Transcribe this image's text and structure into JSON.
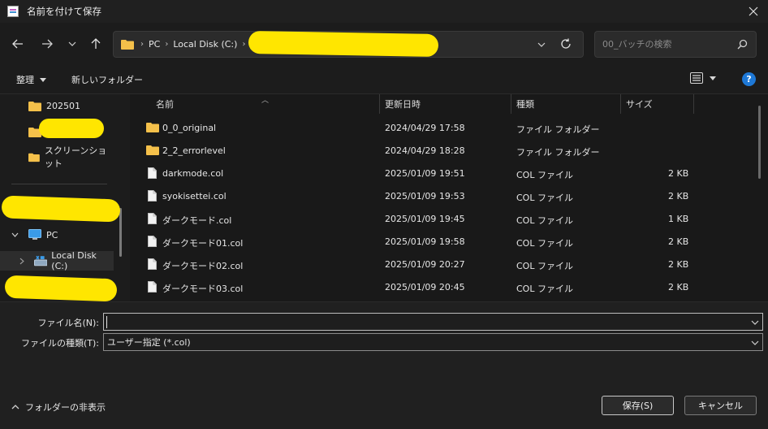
{
  "window": {
    "title": "名前を付けて保存"
  },
  "breadcrumbs": [
    "PC",
    "Local Disk (C:)"
  ],
  "search": {
    "placeholder": "00_バッチの検索"
  },
  "toolbar": {
    "organize": "整理",
    "new_folder": "新しいフォルダー"
  },
  "nav": {
    "items": [
      {
        "label": "202501",
        "icon": "folder-icon"
      },
      {
        "label": "",
        "icon": "folder-icon"
      },
      {
        "label": "スクリーンショット",
        "icon": "folder-icon"
      }
    ],
    "pc_label": "PC",
    "disk_label": "Local Disk (C:)"
  },
  "columns": {
    "name": "名前",
    "date": "更新日時",
    "type": "種類",
    "size": "サイズ"
  },
  "files": [
    {
      "name": "0_0_original",
      "date": "2024/04/29 17:58",
      "type": "ファイル フォルダー",
      "size": "",
      "icon": "folder-icon"
    },
    {
      "name": "2_2_errorlevel",
      "date": "2024/04/29 18:28",
      "type": "ファイル フォルダー",
      "size": "",
      "icon": "folder-icon"
    },
    {
      "name": "darkmode.col",
      "date": "2025/01/09 19:51",
      "type": "COL ファイル",
      "size": "2 KB",
      "icon": "file-icon"
    },
    {
      "name": "syokisettei.col",
      "date": "2025/01/09 19:53",
      "type": "COL ファイル",
      "size": "2 KB",
      "icon": "file-icon"
    },
    {
      "name": "ダークモード.col",
      "date": "2025/01/09 19:45",
      "type": "COL ファイル",
      "size": "1 KB",
      "icon": "file-icon"
    },
    {
      "name": "ダークモード01.col",
      "date": "2025/01/09 19:58",
      "type": "COL ファイル",
      "size": "2 KB",
      "icon": "file-icon"
    },
    {
      "name": "ダークモード02.col",
      "date": "2025/01/09 20:27",
      "type": "COL ファイル",
      "size": "2 KB",
      "icon": "file-icon"
    },
    {
      "name": "ダークモード03.col",
      "date": "2025/01/09 20:45",
      "type": "COL ファイル",
      "size": "2 KB",
      "icon": "file-icon"
    }
  ],
  "save_form": {
    "filename_label": "ファイル名(N):",
    "filename_value": "",
    "filetype_label": "ファイルの種類(T):",
    "filetype_value": "ユーザー指定 (*.col)"
  },
  "footer": {
    "hide_folders": "フォルダーの非表示",
    "save": "保存(S)",
    "cancel": "キャンセル"
  },
  "colors": {
    "accent": "#1e78d6",
    "folder": "#f4c04a",
    "redaction": "#ffe600"
  }
}
